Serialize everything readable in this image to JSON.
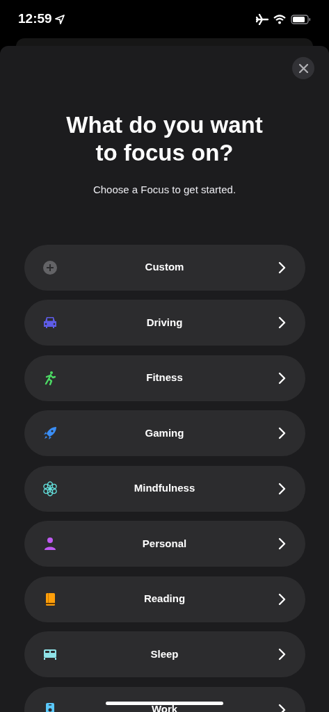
{
  "status_bar": {
    "time": "12:59"
  },
  "sheet": {
    "title": "What do you want to focus on?",
    "subtitle": "Choose a Focus to get started."
  },
  "focus_options": [
    {
      "label": "Custom",
      "kind": "custom",
      "color": "#636366"
    },
    {
      "label": "Driving",
      "kind": "driving",
      "color": "#5e5ce6"
    },
    {
      "label": "Fitness",
      "kind": "fitness",
      "color": "#4cd964"
    },
    {
      "label": "Gaming",
      "kind": "gaming",
      "color": "#3a8ef6"
    },
    {
      "label": "Mindfulness",
      "kind": "mindfulness",
      "color": "#63e0dc"
    },
    {
      "label": "Personal",
      "kind": "personal",
      "color": "#bf5af2"
    },
    {
      "label": "Reading",
      "kind": "reading",
      "color": "#ff9f0a"
    },
    {
      "label": "Sleep",
      "kind": "sleep",
      "color": "#8fe3e8"
    },
    {
      "label": "Work",
      "kind": "work",
      "color": "#5ac8fa"
    }
  ]
}
